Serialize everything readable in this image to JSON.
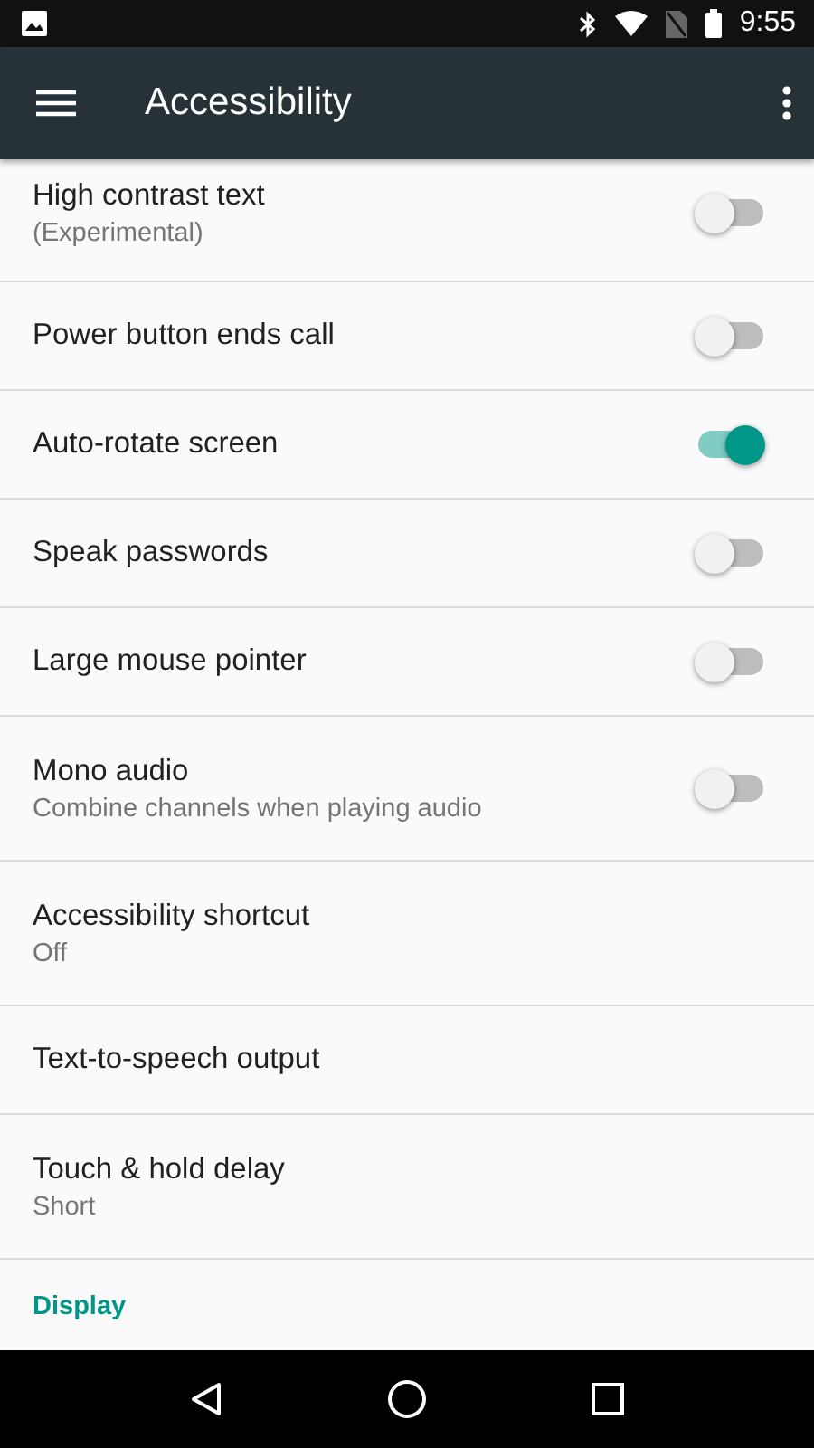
{
  "status_bar": {
    "time": "9:55"
  },
  "app_bar": {
    "title": "Accessibility"
  },
  "settings": [
    {
      "kind": "switch",
      "title": "High contrast text",
      "subtitle": "(Experimental)",
      "on": false
    },
    {
      "kind": "switch",
      "title": "Power button ends call",
      "on": false
    },
    {
      "kind": "switch",
      "title": "Auto-rotate screen",
      "on": true
    },
    {
      "kind": "switch",
      "title": "Speak passwords",
      "on": false
    },
    {
      "kind": "switch",
      "title": "Large mouse pointer",
      "on": false
    },
    {
      "kind": "switch",
      "title": "Mono audio",
      "subtitle": "Combine channels when playing audio",
      "on": false
    },
    {
      "kind": "link",
      "title": "Accessibility shortcut",
      "subtitle": "Off"
    },
    {
      "kind": "link",
      "title": "Text-to-speech output"
    },
    {
      "kind": "link",
      "title": "Touch & hold delay",
      "subtitle": "Short"
    }
  ],
  "section_header": "Display"
}
